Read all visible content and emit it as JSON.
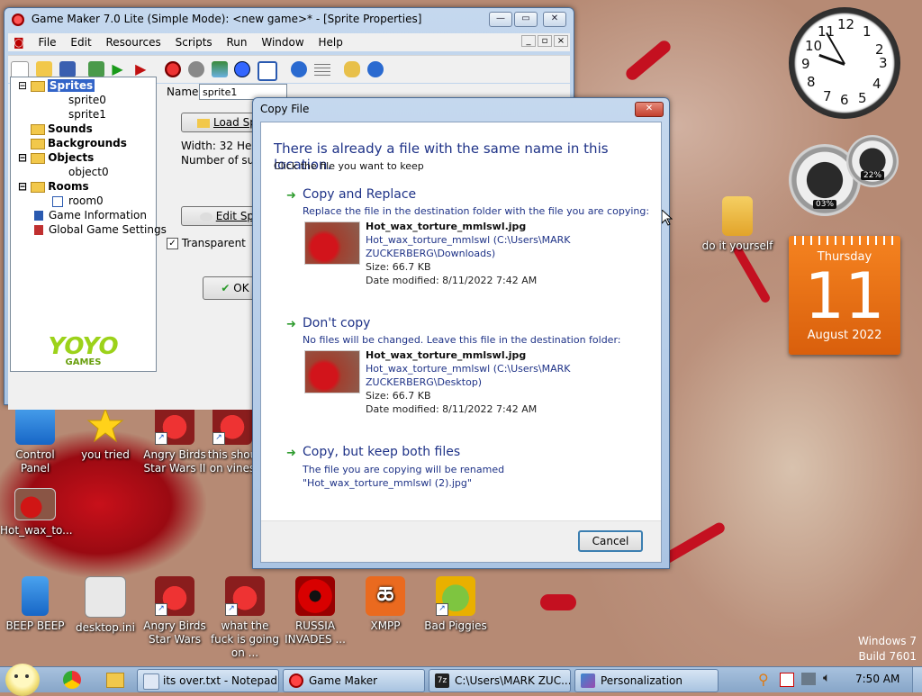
{
  "desktop": {
    "icons": [
      {
        "label": "Control Panel"
      },
      {
        "label": "you tried"
      },
      {
        "label": "Angry Birds Star Wars II"
      },
      {
        "label": "this shou on vines"
      },
      {
        "label": "Hot_wax_to..."
      },
      {
        "label": "BEEP BEEP"
      },
      {
        "label": "desktop.ini"
      },
      {
        "label": "Angry Birds Star Wars"
      },
      {
        "label": "what the fuck is going on ..."
      },
      {
        "label": "RUSSIA INVADES ..."
      },
      {
        "label": "XMPP"
      },
      {
        "label": "Bad Piggies"
      },
      {
        "label": "do it yourself"
      }
    ],
    "watermark_line1": "Windows 7",
    "watermark_line2": "Build 7601"
  },
  "gadgets": {
    "clock_numbers": [
      "12",
      "1",
      "2",
      "3",
      "4",
      "5",
      "6",
      "7",
      "8",
      "9",
      "10",
      "11"
    ],
    "cpu_meter_left": "03%",
    "cpu_meter_right": "22%",
    "calendar": {
      "day_name": "Thursday",
      "day": "11",
      "month_year": "August 2022"
    }
  },
  "gamemaker": {
    "title": "Game Maker 7.0 Lite (Simple Mode): <new game>* - [Sprite Properties]",
    "menu": [
      "File",
      "Edit",
      "Resources",
      "Scripts",
      "Run",
      "Window",
      "Help"
    ],
    "tree": {
      "sprites": "Sprites",
      "sprite0": "sprite0",
      "sprite1": "sprite1",
      "sounds": "Sounds",
      "backgrounds": "Backgrounds",
      "objects": "Objects",
      "object0": "object0",
      "rooms": "Rooms",
      "room0": "room0",
      "game_info": "Game Information",
      "global_settings": "Global Game Settings"
    },
    "logo_text": "YOYO",
    "logo_sub": "GAMES",
    "sprite_props": {
      "name_label": "Name:",
      "name_value": "sprite1",
      "load_button": "Load Sp",
      "width_label": "Width: 32",
      "height_label": "Hei",
      "subimages_label": "Number of subim",
      "edit_button": "Edit Sp",
      "transparent_label": "Transparent",
      "ok_button": "OK"
    }
  },
  "dialog": {
    "title": "Copy File",
    "heading": "There is already a file with the same name in this location.",
    "subheading": "Click the file you want to keep",
    "options": [
      {
        "title": "Copy and Replace",
        "subtitle": "Replace the file in the destination folder with the file you are copying:",
        "file_name": "Hot_wax_torture_mmlswl.jpg",
        "file_path": "Hot_wax_torture_mmlswl (C:\\Users\\MARK ZUCKERBERG\\Downloads)",
        "size": "Size: 66.7 KB",
        "date": "Date modified: 8/11/2022 7:42 AM"
      },
      {
        "title": "Don't copy",
        "subtitle": "No files will be changed. Leave this file in the destination folder:",
        "file_name": "Hot_wax_torture_mmlswl.jpg",
        "file_path": "Hot_wax_torture_mmlswl (C:\\Users\\MARK ZUCKERBERG\\Desktop)",
        "size": "Size: 66.7 KB",
        "date": "Date modified: 8/11/2022 7:42 AM"
      },
      {
        "title": "Copy, but keep both files",
        "subtitle": "The file you are copying will be renamed \"Hot_wax_torture_mmlswl (2).jpg\""
      }
    ],
    "cancel_button": "Cancel"
  },
  "taskbar": {
    "buttons": [
      {
        "label": "its over.txt - Notepad"
      },
      {
        "label": "Game Maker"
      },
      {
        "label": "C:\\Users\\MARK ZUC..."
      },
      {
        "label": "Personalization"
      }
    ],
    "time": "7:50 AM"
  }
}
